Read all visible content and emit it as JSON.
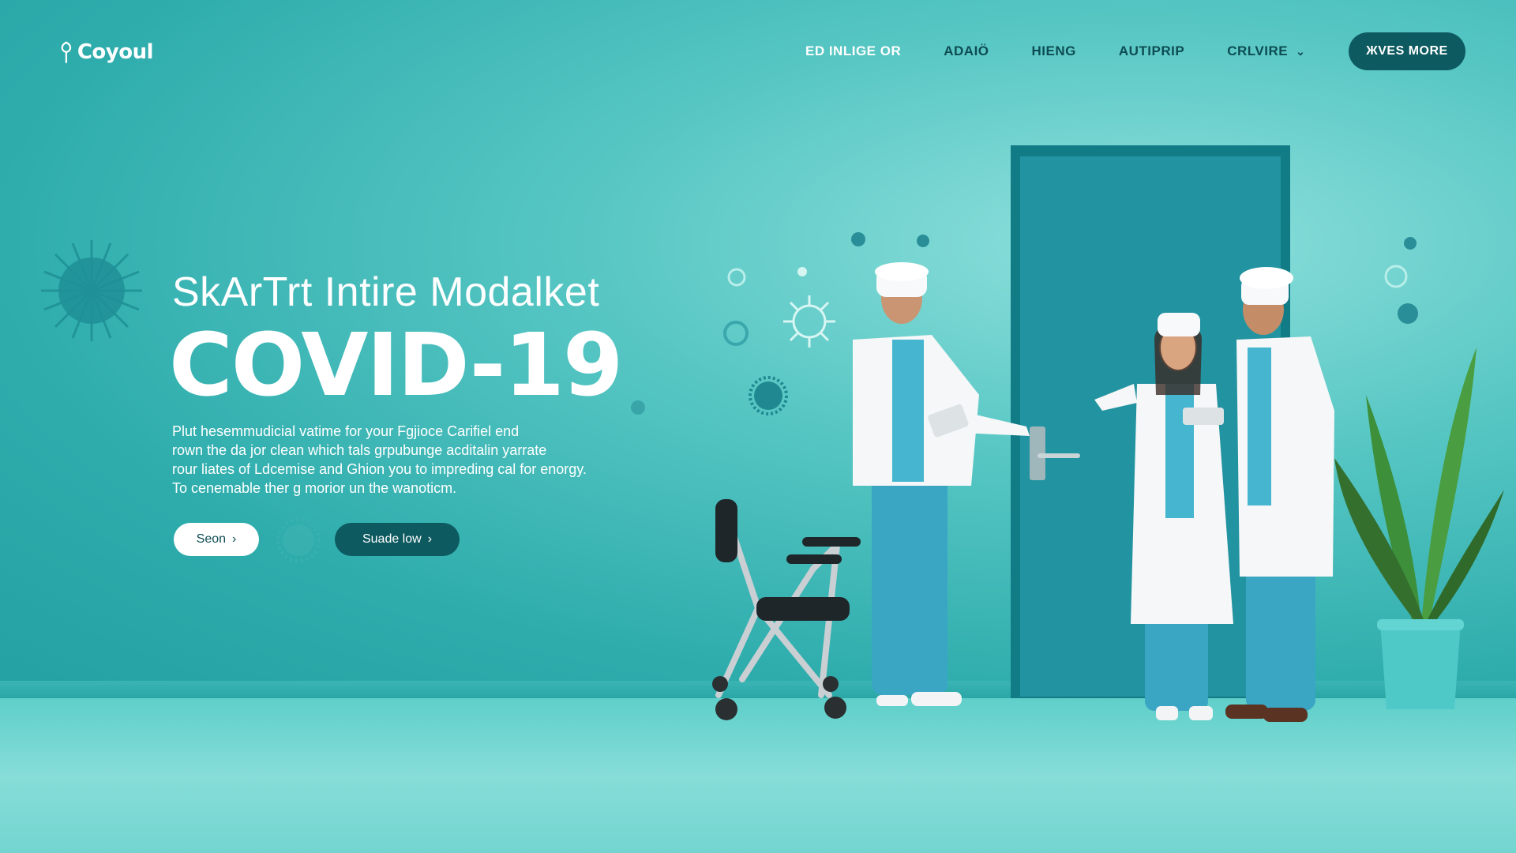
{
  "brand": {
    "name": "Coyoul"
  },
  "nav": {
    "items": [
      {
        "label": "ED INLIGE OR"
      },
      {
        "label": "ADAIÖ"
      },
      {
        "label": "HIENG"
      },
      {
        "label": "AUTIPRIP"
      },
      {
        "label": "CRLVIRE",
        "dropdown": true
      }
    ],
    "cta_label": "ЖVES MORE",
    "chevron_icon": "chevron-down-icon"
  },
  "hero": {
    "subtitle": "SkArTrt Intire Modalket",
    "title": "COVID-19",
    "description_lines": [
      "Plut hesemmudicial vatime for your Fgjioce Carifiel end",
      "rown the da jor clean which tals grpubunge acditalin yarrate",
      "rour liates of Ldcemise and Ghion you to impreding cal for enorgy.",
      "To cenemable ther g morior un the wanoticm."
    ],
    "button_light_label": "Seon",
    "button_dark_label": "Suade low",
    "arrow": "›"
  },
  "colors": {
    "wall": "#2fadad",
    "accent_dark": "#0d5a60",
    "nav_text": "#0c4c52",
    "white": "#ffffff",
    "door": "#1f8f98"
  }
}
